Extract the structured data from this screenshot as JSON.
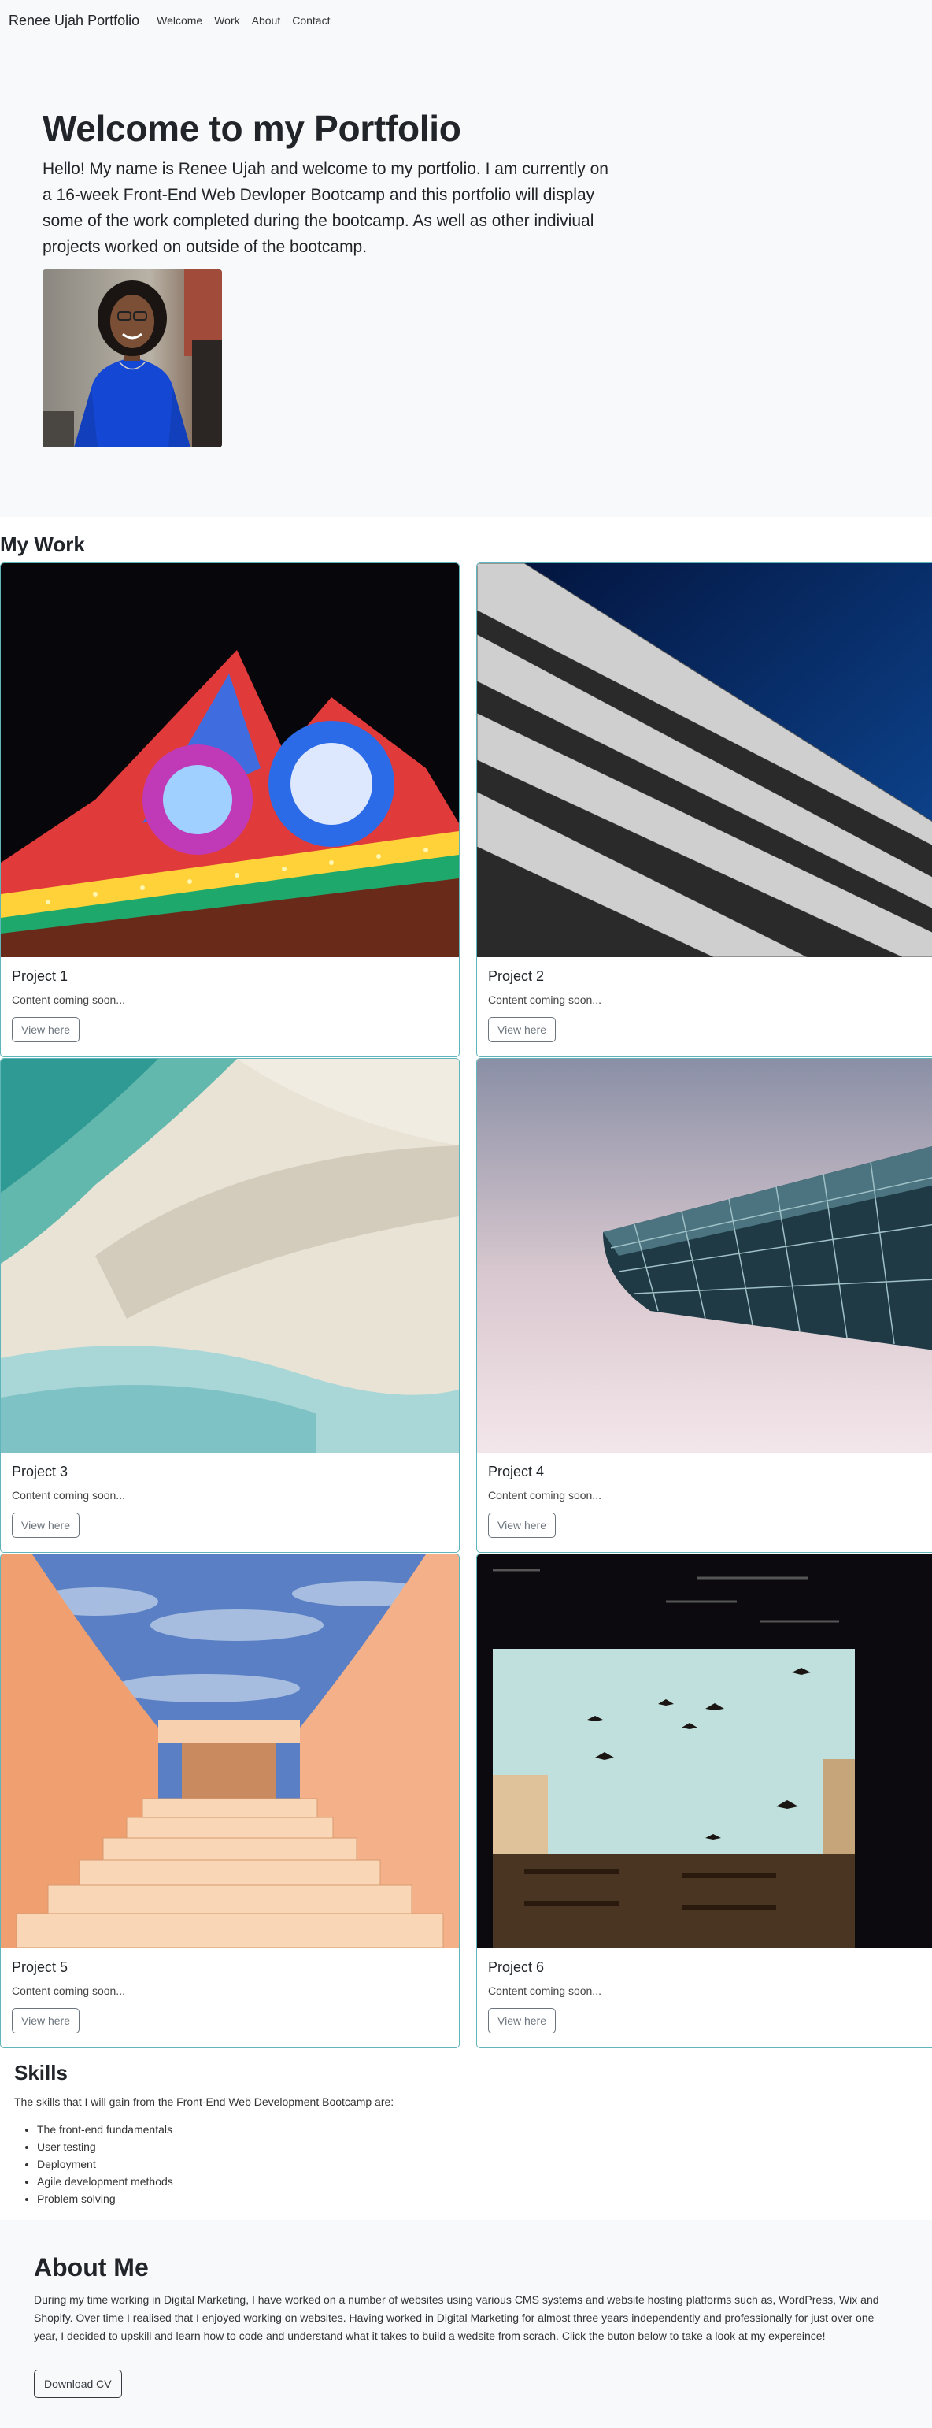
{
  "navbar": {
    "brand": "Renee Ujah Portfolio",
    "links": [
      "Welcome",
      "Work",
      "About",
      "Contact"
    ]
  },
  "hero": {
    "title": "Welcome to my Portfolio",
    "lead": "Hello! My name is Renee Ujah and welcome to my portfolio. I am currently on a 16-week Front-End Web Devloper Bootcamp and this portfolio will display some of the work completed during the bootcamp. As well as other indiviual projects worked on outside of the bootcamp."
  },
  "work": {
    "title": "My Work",
    "projects": [
      {
        "title": "Project 1",
        "text": "Content coming soon...",
        "button": "View here"
      },
      {
        "title": "Project 2",
        "text": "Content coming soon...",
        "button": "View here"
      },
      {
        "title": "Project 3",
        "text": "Content coming soon...",
        "button": "View here"
      },
      {
        "title": "Project 4",
        "text": "Content coming soon...",
        "button": "View here"
      },
      {
        "title": "Project 5",
        "text": "Content coming soon...",
        "button": "View here"
      },
      {
        "title": "Project 6",
        "text": "Content coming soon...",
        "button": "View here"
      }
    ]
  },
  "skills": {
    "title": "Skills",
    "intro": "The skills that I will gain from the Front-End Web Development Bootcamp are:",
    "items": [
      "The front-end fundamentals",
      "User testing",
      "Deployment",
      "Agile development methods",
      "Problem solving"
    ]
  },
  "about": {
    "title": "About Me",
    "text": "During my time working in Digital Marketing, I have worked on a number of websites using various CMS systems and website hosting platforms such as, WordPress, Wix and Shopify. Over time I realised that I enjoyed working on websites. Having worked in Digital Marketing for almost three years independently and professionally for just over one year, I decided to upskill and learn how to code and understand what it takes to build a wedsite from scrach. Click the buton below to take a look at my expereince!",
    "button": "Download CV"
  },
  "colors": {
    "card_border": "#5fb5b9",
    "light_bg": "#f8f9fa"
  }
}
